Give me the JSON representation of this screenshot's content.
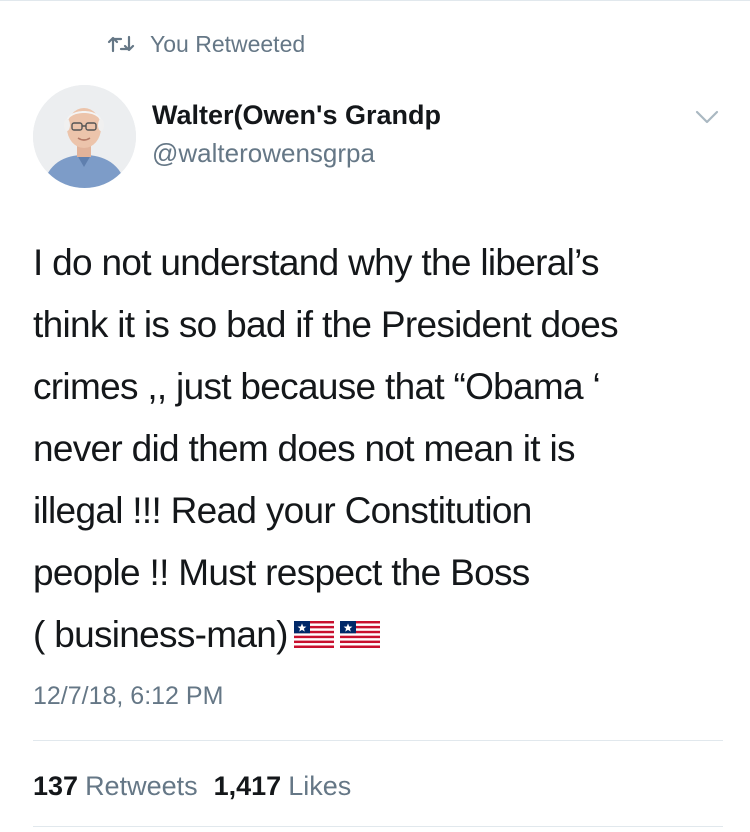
{
  "retweet_label": "You Retweeted",
  "author": {
    "display_name": "Walter(Owen's Grandp",
    "handle": "@walterowensgrpa"
  },
  "tweet": {
    "lines": [
      "I do not understand why the liberal’s",
      "think it is so bad if the President does",
      "crimes ,, just because that “Obama ‘",
      "never did them does not mean it is",
      "illegal !!! Read your Constitution",
      "people !! Must respect the Boss",
      "( business-man)"
    ],
    "emoji": [
      "liberia-flag-emoji",
      "liberia-flag-emoji"
    ],
    "timestamp": "12/7/18, 6:12 PM"
  },
  "stats": {
    "retweets_count": "137",
    "retweets_label": "Retweets",
    "likes_count": "1,417",
    "likes_label": "Likes"
  },
  "colors": {
    "text": "#14171a",
    "secondary": "#657786",
    "divider": "#e1e8ed",
    "flag_red": "#c8102e",
    "flag_blue": "#002868"
  }
}
